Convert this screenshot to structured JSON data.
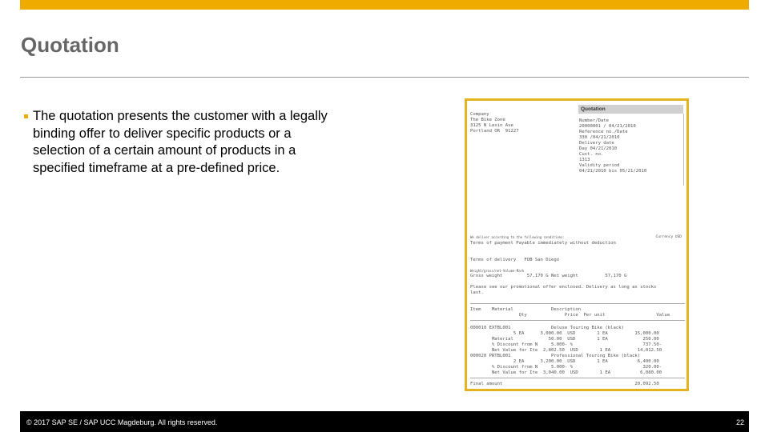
{
  "slide": {
    "title": "Quotation",
    "bullet": "The quotation presents the customer with a legally binding offer to deliver specific products or a selection of a certain amount of products in a specified timeframe at a pre-defined price.",
    "accent": "#f0ab00"
  },
  "doc": {
    "header": "Quotation",
    "company": [
      "Company",
      "The Bike Zone",
      "3125 N Lexin Ave",
      "Portland OR  91227"
    ],
    "right": [
      "Number/Date",
      "20000001 / 04/21/2010",
      "Reference no./Date",
      "330 /04/21/2010",
      "Delivery date",
      "Day 04/21/2010",
      "Cust. no.",
      "1313",
      "Validity period",
      "04/21/2010 bis 05/21/2010"
    ],
    "conditions": "We deliver according to the following conditions:",
    "currency": "Currency USD",
    "payment": "Terms of payment Payable immediately without deduction",
    "delivery": "Terms of delivery   FOB San Diego",
    "weight_label": "Weight/gross/net-Volume-Mark",
    "weight": "Gross weight         57,170 G Net weight          57,170 G",
    "promo1": "Please see our promotional offer enclosed. Delivery as long as stocks",
    "promo2": "last.",
    "col1": "Item    Material              Description",
    "col2": "                  Qty              Price  Per unit                   Value",
    "rows": [
      "000010 EXTBL001               Deluxe Touring Bike (black)",
      "                5 EA      3,000.00  USD        1 EA          15,000.00",
      "        Material             50.00  USD        1 EA             250.00",
      "        % Discount from N     5.000- %                          737.50-",
      "        Net Value for Ite  2,802.50  USD        1 EA          14,012.50",
      "000020 PRTBL001               Professional Touring Bike (black)",
      "                2 EA      3,200.00  USD        1 EA           6,400.00",
      "        % Discount from N     5.000- %                          320.00-",
      "        Net Value for Ite  3,040.00  USD        1 EA           6,080.00"
    ],
    "total": "Final amount                                                 20,092.50"
  },
  "footer": {
    "copyright": "© 2017 SAP SE / SAP UCC Magdeburg. All rights reserved.",
    "page": "22"
  }
}
